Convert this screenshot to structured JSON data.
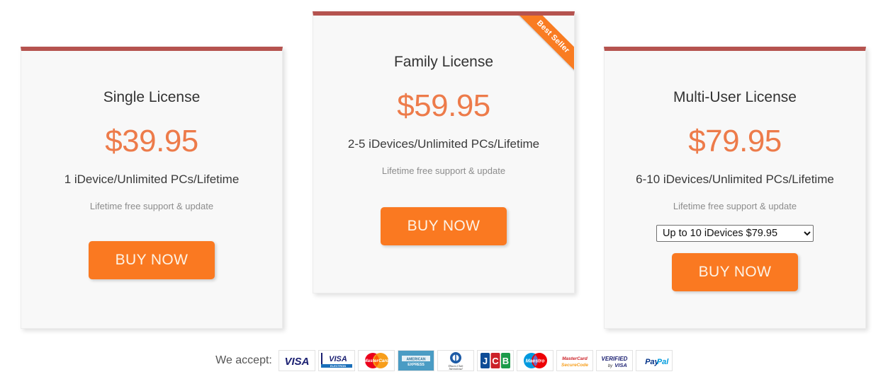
{
  "pricing": {
    "plans": [
      {
        "id": "single",
        "title": "Single License",
        "price": "$39.95",
        "description": "1 iDevice/Unlimited PCs/Lifetime",
        "support": "Lifetime free support & update",
        "buy_label": "BUY NOW",
        "ribbon": null,
        "select_value": null
      },
      {
        "id": "family",
        "title": "Family License",
        "price": "$59.95",
        "description": "2-5 iDevices/Unlimited PCs/Lifetime",
        "support": "Lifetime free support & update",
        "buy_label": "BUY NOW",
        "ribbon": "Best Seller",
        "select_value": null
      },
      {
        "id": "multi",
        "title": "Multi-User License",
        "price": "$79.95",
        "description": "6-10 iDevices/Unlimited PCs/Lifetime",
        "support": "Lifetime free support & update",
        "buy_label": "BUY NOW",
        "ribbon": null,
        "select_value": "Up to 10 iDevices $79.95"
      }
    ]
  },
  "payments": {
    "label": "We accept:",
    "methods": [
      {
        "name": "visa",
        "text": "VISA"
      },
      {
        "name": "visa-electron",
        "text": "VISA ELECTRON"
      },
      {
        "name": "mastercard",
        "text": "MasterCard"
      },
      {
        "name": "american-express",
        "text": "AMERICAN EXPRESS"
      },
      {
        "name": "diners-club-international",
        "text": "Diners Club International"
      },
      {
        "name": "jcb",
        "text": "JCB"
      },
      {
        "name": "maestro",
        "text": "Maestro"
      },
      {
        "name": "mastercard-securecode",
        "text": "MasterCard SecureCode"
      },
      {
        "name": "verified-by-visa",
        "text": "VERIFIED by VISA"
      },
      {
        "name": "paypal",
        "text": "PayPal"
      }
    ]
  },
  "colors": {
    "card_top_border": "#b5534f",
    "price": "#ed7b4a",
    "buy_button": "#fa7921",
    "ribbon": "#f97c22",
    "card_background": "#f8f8f8",
    "page_background": "#ffffff"
  }
}
